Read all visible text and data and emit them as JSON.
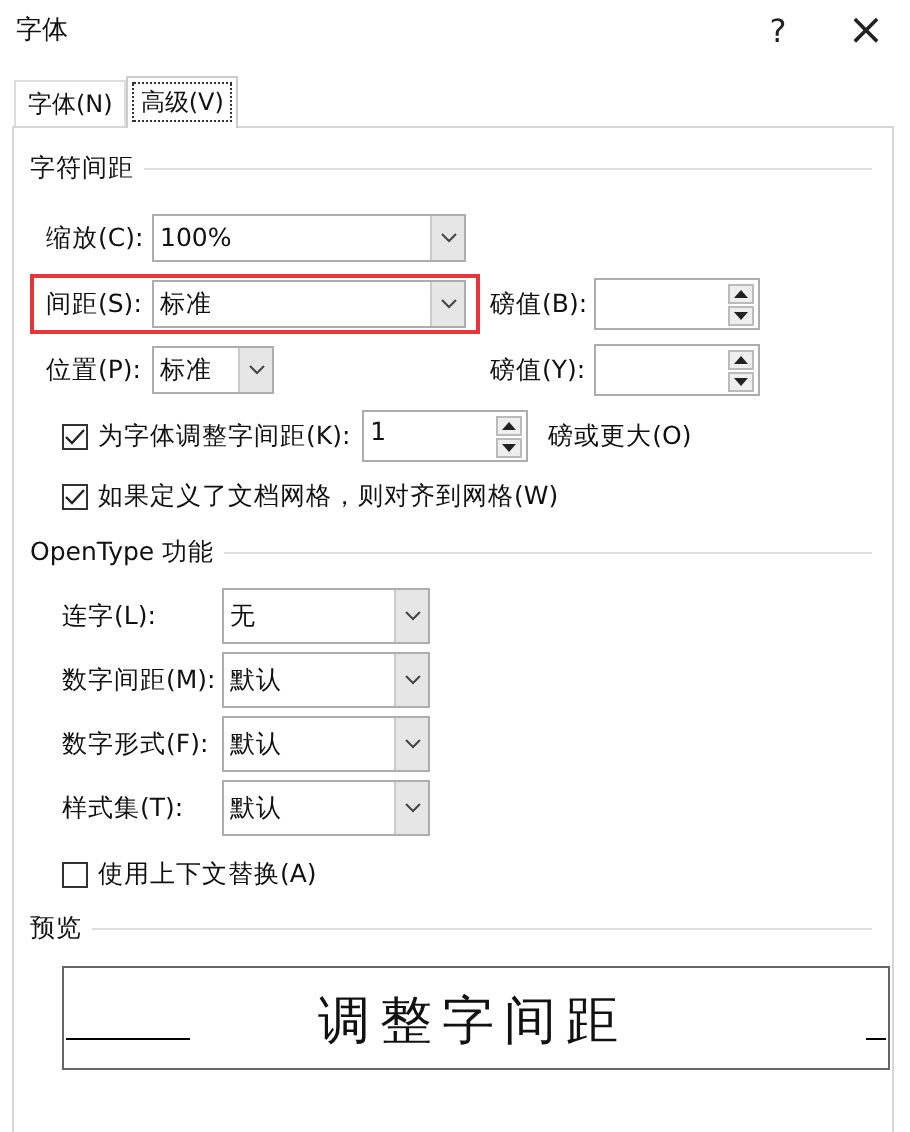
{
  "window": {
    "title": "字体",
    "help": "?",
    "close": "×"
  },
  "tabs": [
    {
      "label": "字体(N)",
      "selected": false
    },
    {
      "label": "高级(V)",
      "selected": true
    }
  ],
  "spacing": {
    "heading": "字符间距",
    "rows": [
      {
        "label": "缩放(C):",
        "value": "100%",
        "kind": "wide",
        "highlighted": false
      },
      {
        "label": "间距(S):",
        "value": "标准",
        "kind": "wide",
        "highlighted": true,
        "by_label": "磅值(B):"
      },
      {
        "label": "位置(P):",
        "value": "标准",
        "kind": "narrow",
        "highlighted": false,
        "by_label": "磅值(Y):"
      }
    ],
    "kerning": {
      "label": "为字体调整字间距(K):",
      "checked": true,
      "value": "1",
      "suffix": "磅或更大(O)"
    },
    "grid": {
      "label": "如果定义了文档网格，则对齐到网格(W)",
      "checked": true
    }
  },
  "opentype": {
    "heading": "OpenType 功能",
    "rows": [
      {
        "label": "连字(L):",
        "value": "无"
      },
      {
        "label": "数字间距(M):",
        "value": "默认"
      },
      {
        "label": "数字形式(F):",
        "value": "默认"
      },
      {
        "label": "样式集(T):",
        "value": "默认"
      }
    ],
    "contextual": {
      "label": "使用上下文替换(A)",
      "checked": false
    }
  },
  "preview": {
    "heading": "预览",
    "sample": "调整字间距"
  }
}
